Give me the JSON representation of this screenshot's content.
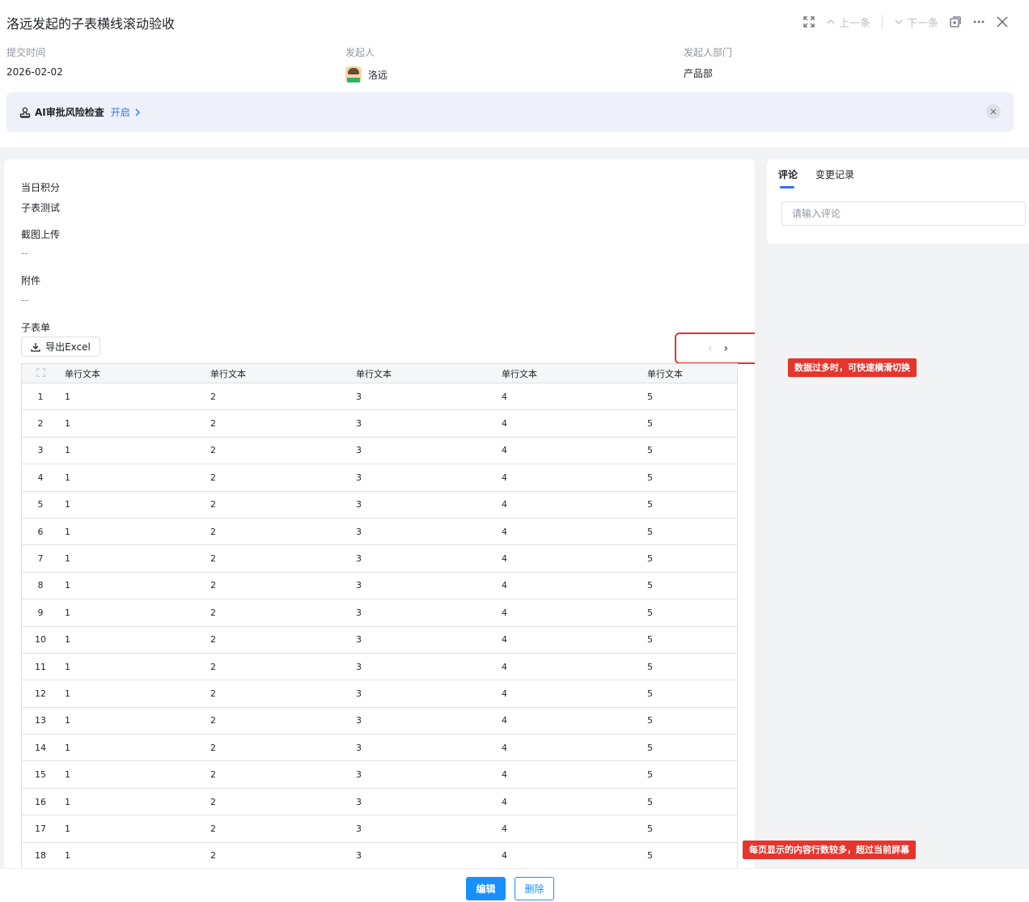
{
  "page": {
    "title": "洛远发起的子表横线滚动验收"
  },
  "toolbar": {
    "expand_icon": "expand-icon",
    "prev_label": "上一条",
    "next_label": "下一条",
    "copy_icon": "copy-window-icon",
    "more_icon": "more-icon",
    "close_icon": "close-icon"
  },
  "meta": {
    "submit_time_label": "提交时间",
    "submit_time_value": "2026-02-02",
    "initiator_label": "发起人",
    "initiator_value": "洛远",
    "dept_label": "发起人部门",
    "dept_value": "产品部"
  },
  "ai_bar": {
    "label": "AI审批风险检查",
    "link": "开启"
  },
  "form": {
    "fields": [
      {
        "label": "当日积分",
        "value": "子表测试"
      },
      {
        "label": "截图上传",
        "value": "--"
      },
      {
        "label": "附件",
        "value": "--"
      }
    ],
    "subtable_label": "子表单",
    "export_label": "导出Excel",
    "pager_prev": "‹",
    "pager_next": "›"
  },
  "table": {
    "headers": [
      "单行文本",
      "单行文本",
      "单行文本",
      "单行文本",
      "单行文本"
    ],
    "rows": [
      [
        "1",
        "1",
        "2",
        "3",
        "4",
        "5"
      ],
      [
        "2",
        "1",
        "2",
        "3",
        "4",
        "5"
      ],
      [
        "3",
        "1",
        "2",
        "3",
        "4",
        "5"
      ],
      [
        "4",
        "1",
        "2",
        "3",
        "4",
        "5"
      ],
      [
        "5",
        "1",
        "2",
        "3",
        "4",
        "5"
      ],
      [
        "6",
        "1",
        "2",
        "3",
        "4",
        "5"
      ],
      [
        "7",
        "1",
        "2",
        "3",
        "4",
        "5"
      ],
      [
        "8",
        "1",
        "2",
        "3",
        "4",
        "5"
      ],
      [
        "9",
        "1",
        "2",
        "3",
        "4",
        "5"
      ],
      [
        "10",
        "1",
        "2",
        "3",
        "4",
        "5"
      ],
      [
        "11",
        "1",
        "2",
        "3",
        "4",
        "5"
      ],
      [
        "12",
        "1",
        "2",
        "3",
        "4",
        "5"
      ],
      [
        "13",
        "1",
        "2",
        "3",
        "4",
        "5"
      ],
      [
        "14",
        "1",
        "2",
        "3",
        "4",
        "5"
      ],
      [
        "15",
        "1",
        "2",
        "3",
        "4",
        "5"
      ],
      [
        "16",
        "1",
        "2",
        "3",
        "4",
        "5"
      ],
      [
        "17",
        "1",
        "2",
        "3",
        "4",
        "5"
      ],
      [
        "18",
        "1",
        "2",
        "3",
        "4",
        "5"
      ]
    ]
  },
  "side": {
    "tab_comment": "评论",
    "tab_history": "变更记录",
    "comment_placeholder": "请输入评论"
  },
  "notes": {
    "scroll_note": "数据过多时，可快速横滑切换",
    "rows_note": "每页显示的内容行数较多，超过当前屏幕"
  },
  "footer": {
    "edit_label": "编辑",
    "delete_label": "删除"
  },
  "colors": {
    "accent": "#3370ff",
    "primary_button": "#1890ff",
    "annotation_red": "#e5352d"
  }
}
